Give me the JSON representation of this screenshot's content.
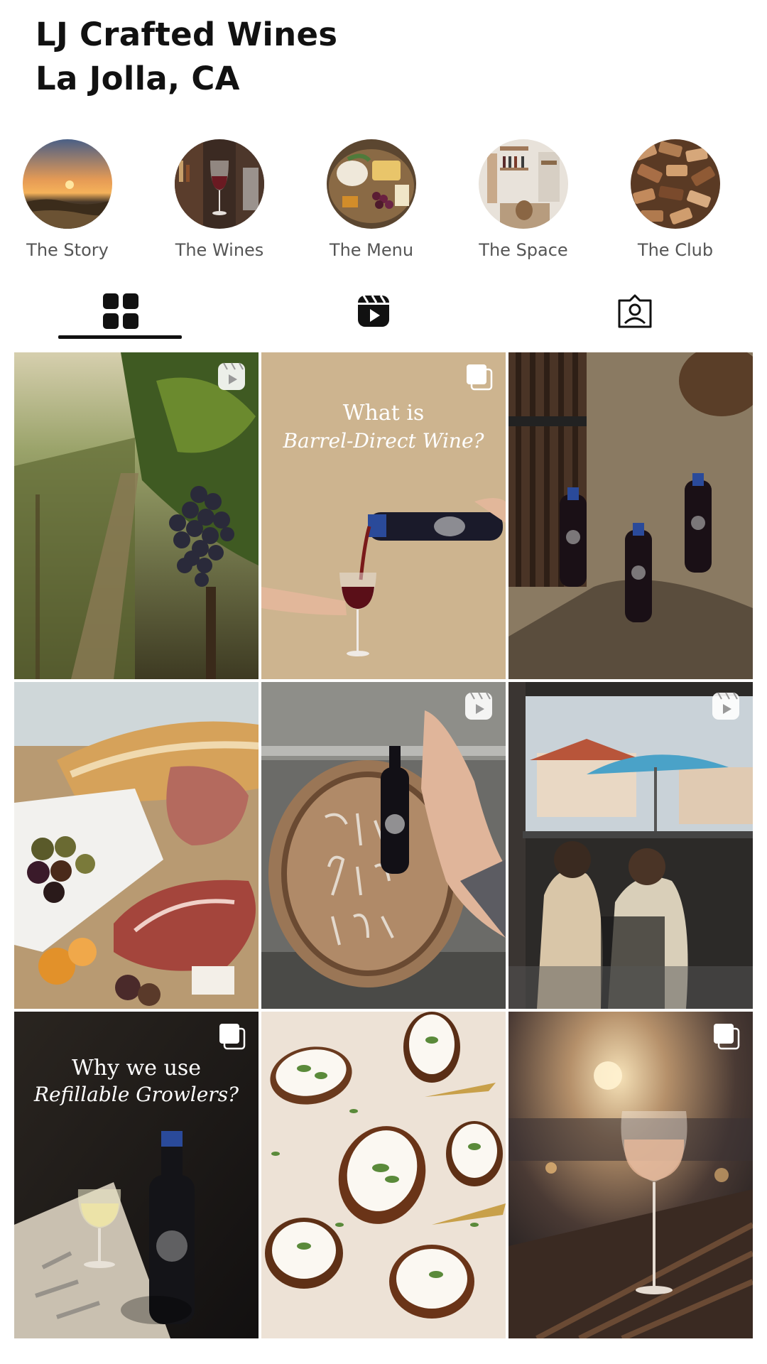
{
  "profile": {
    "name": "LJ Crafted Wines",
    "location": "La Jolla, CA"
  },
  "highlights": [
    {
      "label": "The Story",
      "icon": "sunset-photo"
    },
    {
      "label": "The Wines",
      "icon": "wine-glass-photo"
    },
    {
      "label": "The Menu",
      "icon": "cheese-board-photo"
    },
    {
      "label": "The Space",
      "icon": "interior-photo"
    },
    {
      "label": "The Club",
      "icon": "corks-photo"
    }
  ],
  "tabs": [
    {
      "name": "grid",
      "icon": "grid-icon",
      "selected": true
    },
    {
      "name": "reels",
      "icon": "reels-icon",
      "selected": false
    },
    {
      "name": "tagged",
      "icon": "tagged-icon",
      "selected": false
    }
  ],
  "posts": [
    {
      "subject": "vineyard-grapes",
      "type": "reel"
    },
    {
      "subject": "wine-pour",
      "type": "carousel",
      "overlay_line1": "What is",
      "overlay_line2": "Barrel-Direct Wine?"
    },
    {
      "subject": "wine-bottles-on-pavement",
      "type": "photo"
    },
    {
      "subject": "charcuterie-board",
      "type": "photo"
    },
    {
      "subject": "wine-barrel",
      "type": "reel"
    },
    {
      "subject": "couple-on-patio",
      "type": "reel"
    },
    {
      "subject": "growler-and-glass",
      "type": "carousel",
      "overlay_line1": "Why we use",
      "overlay_line2": "Refillable Growlers?"
    },
    {
      "subject": "crostini-appetizers",
      "type": "photo"
    },
    {
      "subject": "wine-glass-sunset",
      "type": "carousel"
    }
  ],
  "colors": {
    "text": "#111111",
    "label": "#555555",
    "background": "#ffffff"
  }
}
